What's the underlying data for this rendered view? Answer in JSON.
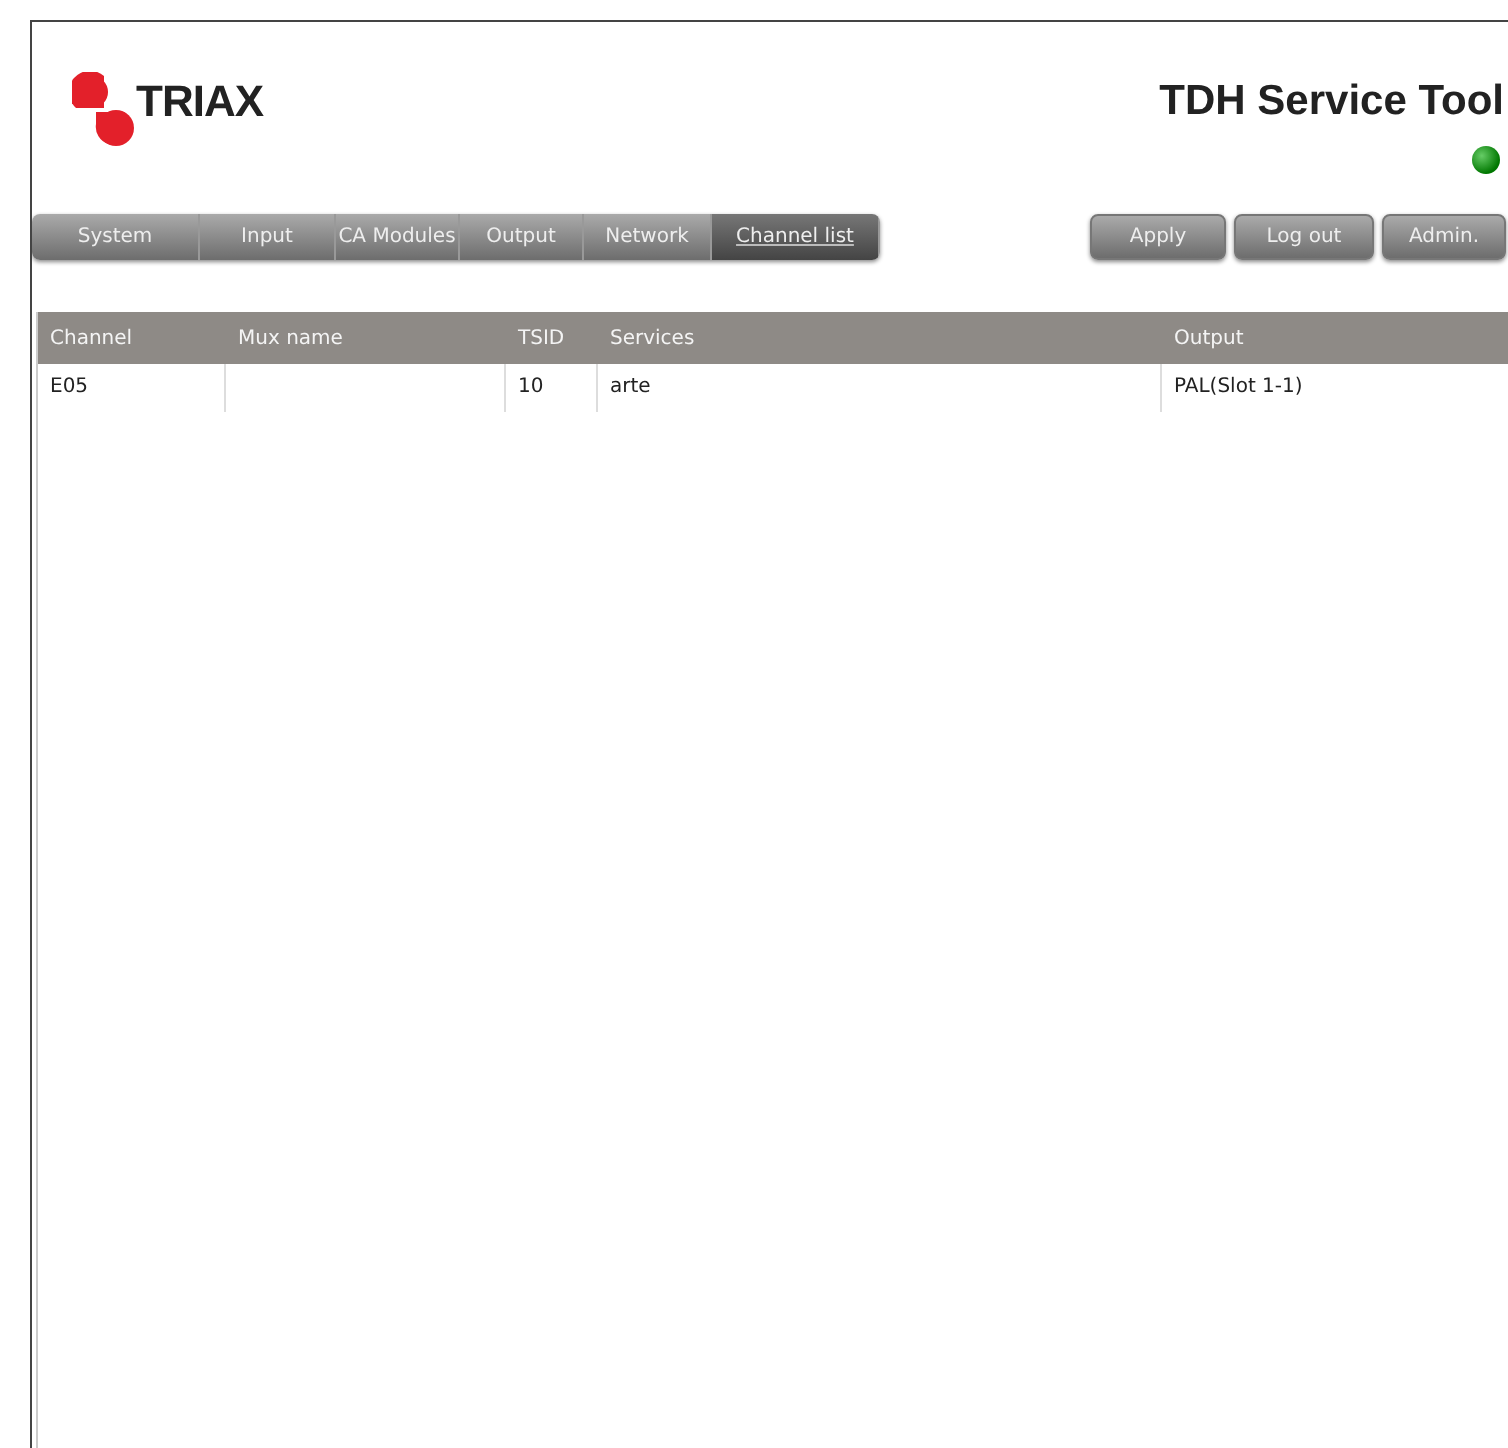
{
  "header": {
    "logo_text": "TRIAX",
    "title": "TDH Service Tool",
    "status_on": true
  },
  "tabs": [
    {
      "label": "System",
      "selected": false
    },
    {
      "label": "Input",
      "selected": false
    },
    {
      "label": "CA Modules",
      "selected": false
    },
    {
      "label": "Output",
      "selected": false
    },
    {
      "label": "Network",
      "selected": false
    },
    {
      "label": "Channel list",
      "selected": true
    }
  ],
  "buttons": [
    "Apply",
    "Log out",
    "Admin."
  ],
  "table": {
    "columns": [
      "Channel",
      "Mux name",
      "TSID",
      "Services",
      "Output"
    ],
    "rows": [
      [
        "E05",
        "",
        "10",
        "arte",
        "PAL(Slot 1-1)"
      ]
    ]
  }
}
